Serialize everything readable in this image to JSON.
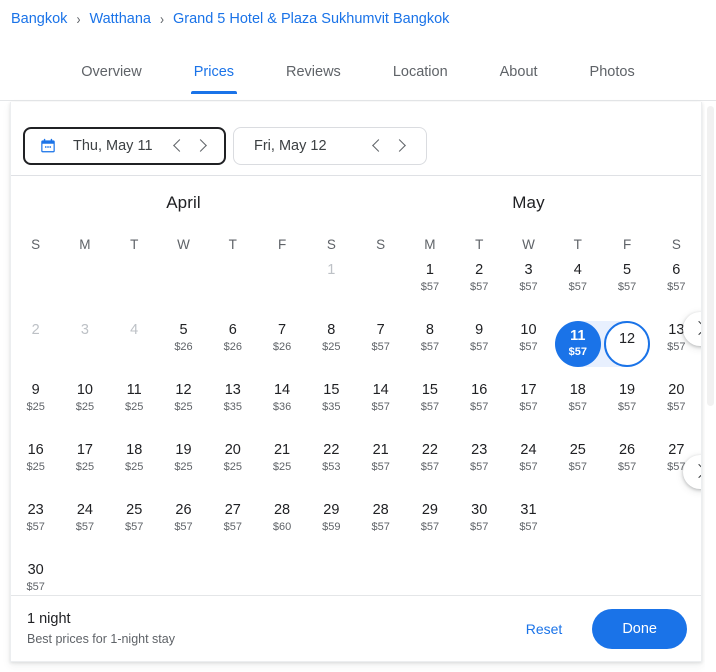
{
  "breadcrumb": {
    "items": [
      "Bangkok",
      "Watthana",
      "Grand 5 Hotel & Plaza Sukhumvit Bangkok"
    ],
    "separator": "›"
  },
  "tabs": [
    {
      "label": "Overview",
      "active": false
    },
    {
      "label": "Prices",
      "active": true
    },
    {
      "label": "Reviews",
      "active": false
    },
    {
      "label": "Location",
      "active": false
    },
    {
      "label": "About",
      "active": false
    },
    {
      "label": "Photos",
      "active": false
    }
  ],
  "date_fields": {
    "check_in": {
      "value": "Thu, May 11",
      "icon": "calendar-icon",
      "focused": true
    },
    "check_out": {
      "value": "Fri, May 12",
      "focused": false
    }
  },
  "calendar": {
    "dow": [
      "S",
      "M",
      "T",
      "W",
      "T",
      "F",
      "S"
    ],
    "currency": "$",
    "months": [
      {
        "name": "April",
        "lead_blanks": 6,
        "days": [
          {
            "d": 1,
            "price": null,
            "disabled": true
          },
          {
            "d": 2,
            "price": null,
            "disabled": true
          },
          {
            "d": 3,
            "price": null,
            "disabled": true
          },
          {
            "d": 4,
            "price": null,
            "disabled": true
          },
          {
            "d": 5,
            "price": "$26",
            "disabled": false
          },
          {
            "d": 6,
            "price": "$26",
            "disabled": false
          },
          {
            "d": 7,
            "price": "$26",
            "disabled": false
          },
          {
            "d": 8,
            "price": "$25",
            "disabled": false
          },
          {
            "d": 9,
            "price": "$25",
            "disabled": false
          },
          {
            "d": 10,
            "price": "$25",
            "disabled": false
          },
          {
            "d": 11,
            "price": "$25",
            "disabled": false
          },
          {
            "d": 12,
            "price": "$25",
            "disabled": false
          },
          {
            "d": 13,
            "price": "$35",
            "disabled": false
          },
          {
            "d": 14,
            "price": "$36",
            "disabled": false
          },
          {
            "d": 15,
            "price": "$35",
            "disabled": false
          },
          {
            "d": 16,
            "price": "$25",
            "disabled": false
          },
          {
            "d": 17,
            "price": "$25",
            "disabled": false
          },
          {
            "d": 18,
            "price": "$25",
            "disabled": false
          },
          {
            "d": 19,
            "price": "$25",
            "disabled": false
          },
          {
            "d": 20,
            "price": "$25",
            "disabled": false
          },
          {
            "d": 21,
            "price": "$25",
            "disabled": false
          },
          {
            "d": 22,
            "price": "$53",
            "disabled": false
          },
          {
            "d": 23,
            "price": "$57",
            "disabled": false
          },
          {
            "d": 24,
            "price": "$57",
            "disabled": false
          },
          {
            "d": 25,
            "price": "$57",
            "disabled": false
          },
          {
            "d": 26,
            "price": "$57",
            "disabled": false
          },
          {
            "d": 27,
            "price": "$57",
            "disabled": false
          },
          {
            "d": 28,
            "price": "$60",
            "disabled": false
          },
          {
            "d": 29,
            "price": "$59",
            "disabled": false
          },
          {
            "d": 30,
            "price": "$57",
            "disabled": false
          }
        ]
      },
      {
        "name": "May",
        "lead_blanks": 1,
        "days": [
          {
            "d": 1,
            "price": "$57",
            "disabled": false
          },
          {
            "d": 2,
            "price": "$57",
            "disabled": false
          },
          {
            "d": 3,
            "price": "$57",
            "disabled": false
          },
          {
            "d": 4,
            "price": "$57",
            "disabled": false
          },
          {
            "d": 5,
            "price": "$57",
            "disabled": false
          },
          {
            "d": 6,
            "price": "$57",
            "disabled": false
          },
          {
            "d": 7,
            "price": "$57",
            "disabled": false
          },
          {
            "d": 8,
            "price": "$57",
            "disabled": false
          },
          {
            "d": 9,
            "price": "$57",
            "disabled": false
          },
          {
            "d": 10,
            "price": "$57",
            "disabled": false
          },
          {
            "d": 11,
            "price": "$57",
            "disabled": false,
            "select": "start"
          },
          {
            "d": 12,
            "price": null,
            "disabled": false,
            "select": "end"
          },
          {
            "d": 13,
            "price": "$57",
            "disabled": false
          },
          {
            "d": 14,
            "price": "$57",
            "disabled": false
          },
          {
            "d": 15,
            "price": "$57",
            "disabled": false
          },
          {
            "d": 16,
            "price": "$57",
            "disabled": false
          },
          {
            "d": 17,
            "price": "$57",
            "disabled": false
          },
          {
            "d": 18,
            "price": "$57",
            "disabled": false
          },
          {
            "d": 19,
            "price": "$57",
            "disabled": false
          },
          {
            "d": 20,
            "price": "$57",
            "disabled": false
          },
          {
            "d": 21,
            "price": "$57",
            "disabled": false
          },
          {
            "d": 22,
            "price": "$57",
            "disabled": false
          },
          {
            "d": 23,
            "price": "$57",
            "disabled": false
          },
          {
            "d": 24,
            "price": "$57",
            "disabled": false
          },
          {
            "d": 25,
            "price": "$57",
            "disabled": false
          },
          {
            "d": 26,
            "price": "$57",
            "disabled": false
          },
          {
            "d": 27,
            "price": "$57",
            "disabled": false
          },
          {
            "d": 28,
            "price": "$57",
            "disabled": false
          },
          {
            "d": 29,
            "price": "$57",
            "disabled": false
          },
          {
            "d": 30,
            "price": "$57",
            "disabled": false
          },
          {
            "d": 31,
            "price": "$57",
            "disabled": false
          }
        ]
      }
    ]
  },
  "footer": {
    "nights_title": "1 night",
    "nights_sub": "Best prices for 1-night stay",
    "reset_label": "Reset",
    "done_label": "Done"
  },
  "colors": {
    "accent": "#1a73e8",
    "selection_band": "#e8f0fe",
    "text_primary": "#202124",
    "text_secondary": "#5f6368",
    "disabled": "#bdc1c6"
  }
}
